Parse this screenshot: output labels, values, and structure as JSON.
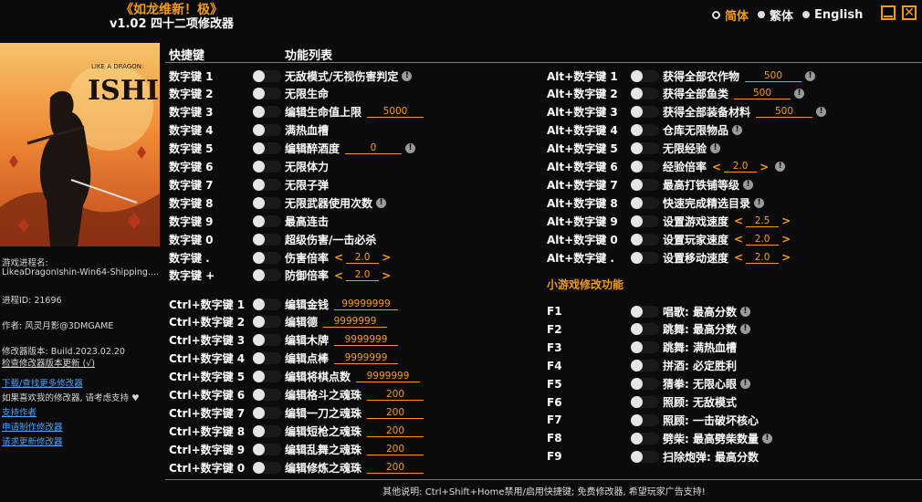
{
  "title": {
    "main": "《如龙维新！极》",
    "sub": "v1.02 四十二项修改器"
  },
  "languages": [
    {
      "label": "简体",
      "selected": true
    },
    {
      "label": "繁体",
      "selected": false
    },
    {
      "label": "English",
      "selected": false
    }
  ],
  "cover": {
    "art_text": "LIKE A DRAGON:"
  },
  "info": {
    "process_label": "游戏进程名:",
    "process_name": "LikeaDragonIshin-Win64-Shipping....",
    "pid": "进程ID:  21696",
    "author": "作者:  风灵月影@3DMGAME",
    "version": "修改器版本:  Build.2023.02.20",
    "check_update": "检查修改器版本更新 (√)",
    "download_more": "下载/查找更多修改器",
    "support_text": "如果喜欢我的修改器, 请考虑支持",
    "support_author": "支持作者",
    "request_trainer": "申请制作修改器",
    "request_update": "请求更新修改器"
  },
  "headers": {
    "key": "快捷键",
    "function": "功能列表"
  },
  "left_rows": [
    {
      "key": "数字键 1",
      "fn": "无敌模式/无视伤害判定",
      "info": true
    },
    {
      "key": "数字键 2",
      "fn": "无限生命"
    },
    {
      "key": "数字键 3",
      "fn": "编辑生命值上限",
      "value": "5000"
    },
    {
      "key": "数字键 4",
      "fn": "满热血槽"
    },
    {
      "key": "数字键 5",
      "fn": "编辑醉酒度",
      "value": "0",
      "info": true
    },
    {
      "key": "数字键 6",
      "fn": "无限体力"
    },
    {
      "key": "数字键 7",
      "fn": "无限子弹"
    },
    {
      "key": "数字键 8",
      "fn": "无限武器使用次数",
      "info": true
    },
    {
      "key": "数字键 9",
      "fn": "最高连击"
    },
    {
      "key": "数字键 0",
      "fn": "超级伤害/一击必杀"
    },
    {
      "key": "数字键 .",
      "fn": "伤害倍率",
      "stepper": "2.0"
    },
    {
      "key": "数字键 +",
      "fn": "防御倍率",
      "stepper": "2.0"
    }
  ],
  "ctrl_rows": [
    {
      "key": "Ctrl+数字键 1",
      "fn": "编辑金钱",
      "value": "99999999"
    },
    {
      "key": "Ctrl+数字键 2",
      "fn": "编辑德",
      "value": "9999999"
    },
    {
      "key": "Ctrl+数字键 3",
      "fn": "编辑木牌",
      "value": "9999999"
    },
    {
      "key": "Ctrl+数字键 4",
      "fn": "编辑点棒",
      "value": "9999999"
    },
    {
      "key": "Ctrl+数字键 5",
      "fn": "编辑将棋点数",
      "value": "9999999"
    },
    {
      "key": "Ctrl+数字键 6",
      "fn": "编辑格斗之魂珠",
      "value": "200"
    },
    {
      "key": "Ctrl+数字键 7",
      "fn": "编辑一刀之魂珠",
      "value": "200"
    },
    {
      "key": "Ctrl+数字键 8",
      "fn": "编辑短枪之魂珠",
      "value": "200"
    },
    {
      "key": "Ctrl+数字键 9",
      "fn": "编辑乱舞之魂珠",
      "value": "200"
    },
    {
      "key": "Ctrl+数字键 0",
      "fn": "编辑修炼之魂珠",
      "value": "200"
    }
  ],
  "alt_rows": [
    {
      "key": "Alt+数字键 1",
      "fn": "获得全部农作物",
      "value": "500",
      "info": true
    },
    {
      "key": "Alt+数字键 2",
      "fn": "获得全部鱼类",
      "value": "500",
      "info": true
    },
    {
      "key": "Alt+数字键 3",
      "fn": "获得全部装备材料",
      "value": "500",
      "info": true
    },
    {
      "key": "Alt+数字键 4",
      "fn": "仓库无限物品",
      "info": true
    },
    {
      "key": "Alt+数字键 5",
      "fn": "无限经验",
      "info": true
    },
    {
      "key": "Alt+数字键 6",
      "fn": "经验倍率",
      "stepper": "2.0",
      "info": true
    },
    {
      "key": "Alt+数字键 7",
      "fn": "最高打铁铺等级",
      "info": true
    },
    {
      "key": "Alt+数字键 8",
      "fn": "快速完成精选目录",
      "info": true
    },
    {
      "key": "Alt+数字键 9",
      "fn": "设置游戏速度",
      "stepper": "2.5"
    },
    {
      "key": "Alt+数字键 0",
      "fn": "设置玩家速度",
      "stepper": "2.0"
    },
    {
      "key": "Alt+数字键 .",
      "fn": "设置移动速度",
      "stepper": "2.0"
    }
  ],
  "minigame_title": "小游戏修改功能",
  "f_rows": [
    {
      "key": "F1",
      "fn": "唱歌: 最高分数",
      "info": true
    },
    {
      "key": "F2",
      "fn": "跳舞: 最高分数",
      "info": true
    },
    {
      "key": "F3",
      "fn": "跳舞: 满热血槽"
    },
    {
      "key": "F4",
      "fn": "拼酒: 必定胜利"
    },
    {
      "key": "F5",
      "fn": "猜拳: 无限心眼",
      "info": true
    },
    {
      "key": "F6",
      "fn": "照顾: 无敌模式"
    },
    {
      "key": "F7",
      "fn": "照顾: 一击破坏核心"
    },
    {
      "key": "F8",
      "fn": "劈柴: 最高劈柴数量",
      "info": true
    },
    {
      "key": "F9",
      "fn": "扫除炮弹: 最高分数"
    }
  ],
  "footer": "其他说明:  Ctrl+Shift+Home禁用/启用快捷键; 免费修改器, 希望玩家广告支持!"
}
